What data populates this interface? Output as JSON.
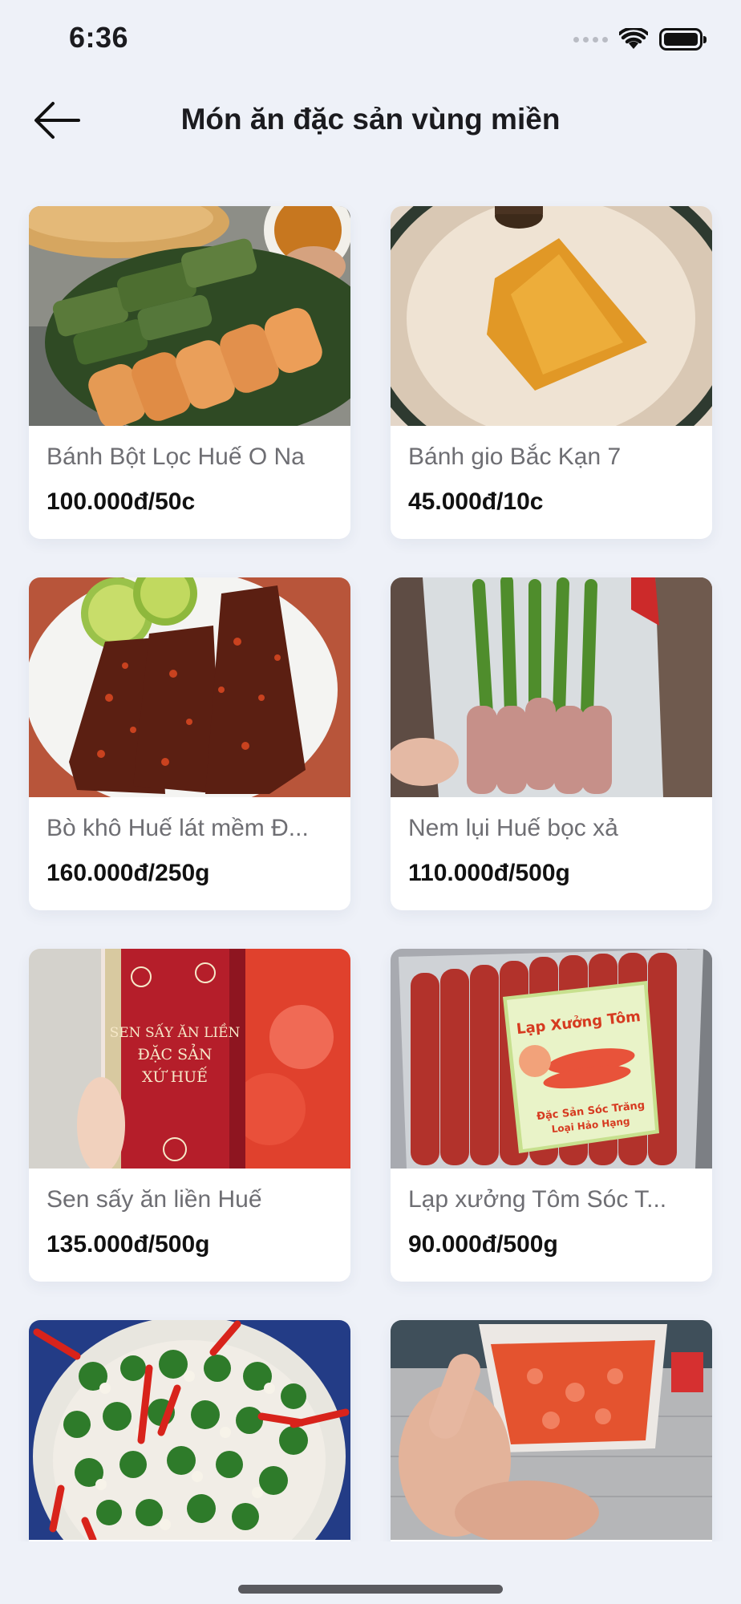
{
  "status_bar": {
    "time": "6:36"
  },
  "header": {
    "title": "Món ăn đặc sản vùng miền"
  },
  "products": [
    {
      "name": "Bánh Bột Lọc Huế O Na",
      "price": "100.000đ/50c"
    },
    {
      "name": "Bánh gio Bắc Kạn 7",
      "price": "45.000đ/10c"
    },
    {
      "name": "Bò khô Huế lát mềm Đ...",
      "price": "160.000đ/250g"
    },
    {
      "name": "Nem lụi Huế bọc xả",
      "price": "110.000đ/500g"
    },
    {
      "name": "Sen sấy ăn liền Huế",
      "price": "135.000đ/500g"
    },
    {
      "name": "Lạp xưởng Tôm Sóc T...",
      "price": "90.000đ/500g"
    },
    {
      "name": "",
      "price": ""
    },
    {
      "name": "",
      "price": ""
    }
  ],
  "image_text": {
    "lotus_jar": [
      "SEN SẤY ĂN LIỀN",
      "ĐẶC SẢN",
      "XỨ HUẾ"
    ],
    "sausage_label": [
      "Lạp Xưởng Tôm",
      "Đặc Sản Sóc Trăng",
      "Loại Hảo Hạng"
    ]
  },
  "icons": {
    "back": "arrow-left-icon",
    "wifi": "wifi-icon",
    "battery": "battery-icon",
    "signal": "signal-icon"
  }
}
